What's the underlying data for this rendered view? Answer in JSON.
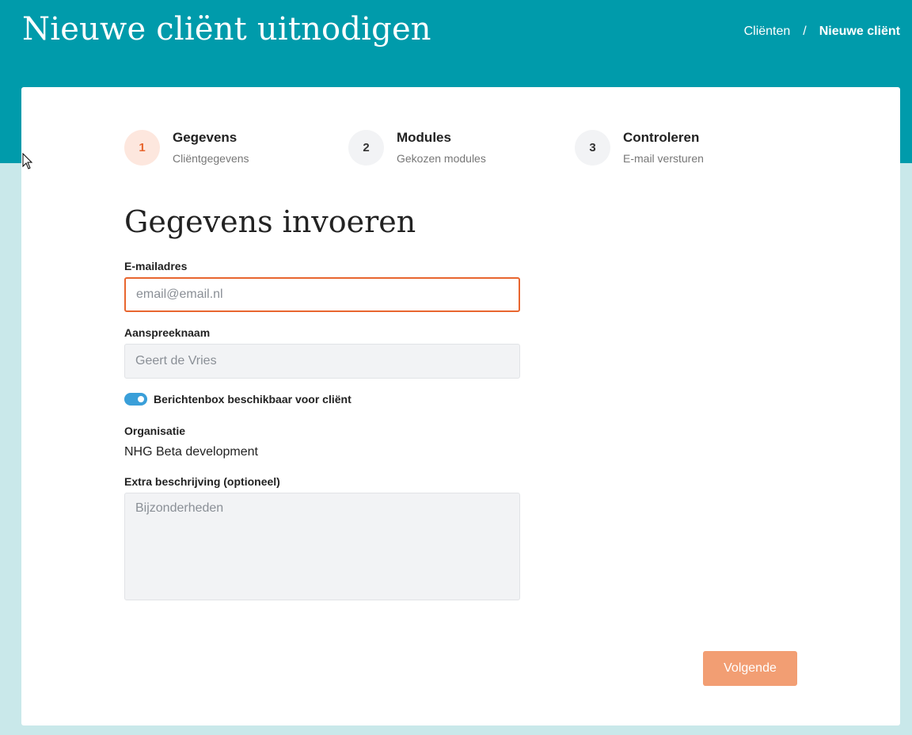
{
  "header": {
    "title": "Nieuwe cliënt uitnodigen",
    "breadcrumb": {
      "parent": "Cliënten",
      "separator": "/",
      "current": "Nieuwe cliënt"
    }
  },
  "steps": [
    {
      "number": "1",
      "title": "Gegevens",
      "subtitle": "Cliëntgegevens",
      "active": true
    },
    {
      "number": "2",
      "title": "Modules",
      "subtitle": "Gekozen modules",
      "active": false
    },
    {
      "number": "3",
      "title": "Controleren",
      "subtitle": "E-mail versturen",
      "active": false
    }
  ],
  "form": {
    "heading": "Gegevens invoeren",
    "email": {
      "label": "E-mailadres",
      "value": "",
      "placeholder": "email@email.nl"
    },
    "name": {
      "label": "Aanspreeknaam",
      "value": "",
      "placeholder": "Geert de Vries"
    },
    "messagebox_toggle": {
      "label": "Berichtenbox beschikbaar voor cliënt",
      "enabled": true
    },
    "organisation": {
      "label": "Organisatie",
      "value": "NHG Beta development"
    },
    "description": {
      "label": "Extra beschrijving (optioneel)",
      "value": "",
      "placeholder": "Bijzonderheden"
    },
    "next_label": "Volgende"
  },
  "colors": {
    "header_bg": "#009bab",
    "page_bg": "#c9e8ea",
    "accent": "#e8662f",
    "button_bg": "#f29e73",
    "toggle_on": "#3a9fd9"
  }
}
